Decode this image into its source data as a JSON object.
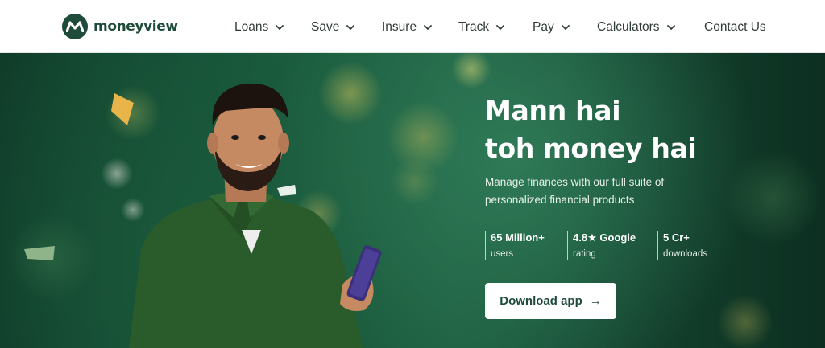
{
  "brand": {
    "name": "moneyview",
    "color": "#1f4b3a"
  },
  "nav": {
    "items": [
      {
        "label": "Loans",
        "has_dropdown": true,
        "icon": "chevron-down-icon"
      },
      {
        "label": "Save",
        "has_dropdown": true,
        "icon": "chevron-down-icon"
      },
      {
        "label": "Insure",
        "has_dropdown": true,
        "icon": "chevron-down-icon"
      },
      {
        "label": "Track",
        "has_dropdown": true,
        "icon": "chevron-down-icon"
      },
      {
        "label": "Pay",
        "has_dropdown": true,
        "icon": "chevron-down-icon"
      },
      {
        "label": "Calculators",
        "has_dropdown": true,
        "icon": "chevron-down-icon"
      },
      {
        "label": "Contact Us",
        "has_dropdown": false
      }
    ]
  },
  "hero": {
    "headline_line1": "Mann hai",
    "headline_line2": "toh money hai",
    "subtext_line1": "Manage finances with our full suite of",
    "subtext_line2": "personalized financial products",
    "stats": [
      {
        "value": "65 Million+",
        "label": "users"
      },
      {
        "value": "4.8★ Google",
        "label": "rating"
      },
      {
        "value": "5 Cr+",
        "label": "downloads"
      }
    ],
    "cta_label": "Download app",
    "cta_icon": "arrow-right-icon",
    "background_color": "#195c3e",
    "shirt_color": "#2a5c2b",
    "phone_color": "#3b2f7a"
  }
}
